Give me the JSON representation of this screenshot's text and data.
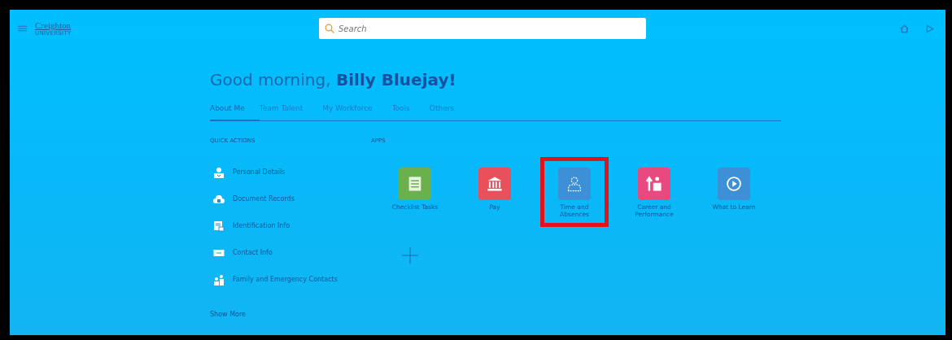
{
  "header": {
    "logo": {
      "name": "Creighton",
      "subtitle": "UNIVERSITY"
    },
    "search": {
      "placeholder": "Search"
    }
  },
  "greeting": {
    "text": "Good morning, ",
    "name": "Billy Bluejay!"
  },
  "tabs": [
    {
      "label": "About Me",
      "selected": true
    },
    {
      "label": "Team Talent",
      "selected": false
    },
    {
      "label": "My Workforce",
      "selected": false
    },
    {
      "label": "Tools",
      "selected": false
    },
    {
      "label": "Others",
      "selected": false
    }
  ],
  "quick_actions": {
    "title": "QUICK ACTIONS",
    "items": [
      {
        "label": "Personal Details",
        "kind": "person"
      },
      {
        "label": "Document Records",
        "kind": "cloud"
      },
      {
        "label": "Identification Info",
        "kind": "card"
      },
      {
        "label": "Contact Info",
        "kind": "mail"
      },
      {
        "label": "Family and Emergency Contacts",
        "kind": "family"
      }
    ],
    "show_more": "Show More"
  },
  "apps": {
    "title": "APPS",
    "items": [
      {
        "label": "Checklist Tasks",
        "kind": "checklist",
        "color": "#6ab04c",
        "highlighted": false
      },
      {
        "label": "Pay",
        "kind": "bank",
        "color": "#e8505b",
        "highlighted": false
      },
      {
        "label": "Time and Absences",
        "kind": "person",
        "color": "#3d8fd6",
        "highlighted": true
      },
      {
        "label": "Career and Performance",
        "kind": "career",
        "color": "#e84a7f",
        "highlighted": false
      },
      {
        "label": "What to Learn",
        "kind": "play",
        "color": "#3d8fd6",
        "highlighted": false
      }
    ]
  }
}
